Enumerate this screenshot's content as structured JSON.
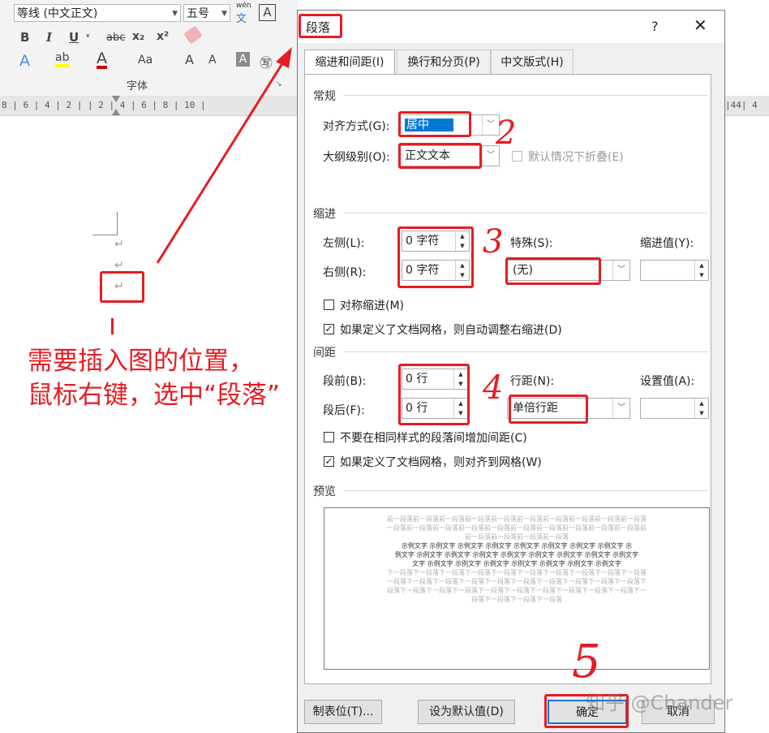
{
  "ribbon": {
    "font_name": "等线 (中文正文)",
    "font_size": "五号",
    "phonetic_top": "wén",
    "phonetic_bottom": "文",
    "border_char": "A",
    "bold": "B",
    "italic": "I",
    "underline": "U",
    "strike": "abc",
    "subscript": "x₂",
    "superscript": "x²",
    "grow": "A",
    "shrink": "A",
    "case": "Aa",
    "shade": "A",
    "enclose": "㊢",
    "group_label": "字体"
  },
  "ruler": {
    "left_text": "8 | 6 | 4 | 2 |   | 2 | 4 | 6 | 8 | 10 |",
    "right_text": "|44| 4"
  },
  "annotation": {
    "line1": "需要插入图的位置，",
    "line2": "鼠标右键，选中“段落”",
    "n2": "2",
    "n3": "3",
    "n4": "4",
    "n5": "5"
  },
  "dialog": {
    "title": "段落",
    "help": "?",
    "close": "✕",
    "tabs": [
      "缩进和间距(I)",
      "换行和分页(P)",
      "中文版式(H)"
    ],
    "general": {
      "section": "常规",
      "align_label": "对齐方式(G):",
      "align_value": "居中",
      "outline_label": "大纲级别(O):",
      "outline_value": "正文文本",
      "collapse_label": "默认情况下折叠(E)"
    },
    "indent": {
      "section": "缩进",
      "left_label": "左侧(L):",
      "left_value": "0 字符",
      "right_label": "右侧(R):",
      "right_value": "0 字符",
      "special_label": "特殊(S):",
      "special_value": "(无)",
      "by_label": "缩进值(Y):",
      "by_value": "",
      "mirror_label": "对称缩进(M)",
      "auto_adjust_label": "如果定义了文档网格，则自动调整右缩进(D)",
      "mirror_checked": false,
      "auto_adjust_checked": true
    },
    "spacing": {
      "section": "间距",
      "before_label": "段前(B):",
      "before_value": "0 行",
      "after_label": "段后(F):",
      "after_value": "0 行",
      "line_label": "行距(N):",
      "line_value": "单倍行距",
      "at_label": "设置值(A):",
      "at_value": "",
      "no_space_label": "不要在相同样式的段落间增加间距(C)",
      "snap_label": "如果定义了文档网格，则对齐到网格(W)",
      "no_space_checked": false,
      "snap_checked": true
    },
    "preview": {
      "section": "预览",
      "prev_lines": [
        "前一段落前一段落前一段落前一段落前一段落前一段落前一段落前一段落前一段落前一段落",
        "一段落前一段落前一段落前一段落前一段落前一段落前一段落前一段落前一段落前一段落前",
        "前一段落前一段落前一段落前一段落"
      ],
      "sample_lines": [
        "示例文字 示例文字 示例文字 示例文字 示例文字 示例文字 示例文字 示例文字 示",
        "例文字 示例文字 示例文字 示例文字 示例文字 示例文字 示例文字 示例文字 示例文字",
        "文字 示例文字 示例文字 示例文字 示例文字 示例文字 示例文字 示例文字"
      ],
      "next_lines": [
        "下一段落下一段落下一段落下一段落下一段落下一段落下一段落下一段落下一段落下一段落",
        "一段落下一段落下一段落下一段落下一段落下一段落下一段落下一段落下一段落下一段落下",
        "段落下一段落下一段落下一段落下一段落下一段落下一段落下一段落下一段落下一段落下一",
        "段落下一段落下一段落下一段落"
      ]
    },
    "buttons": {
      "tabs": "制表位(T)...",
      "default": "设为默认值(D)",
      "ok": "确定",
      "cancel": "取消"
    }
  },
  "watermark": "知乎 @Chander",
  "colors": {
    "annotation": "#e51c23",
    "selection": "#0078d7"
  }
}
